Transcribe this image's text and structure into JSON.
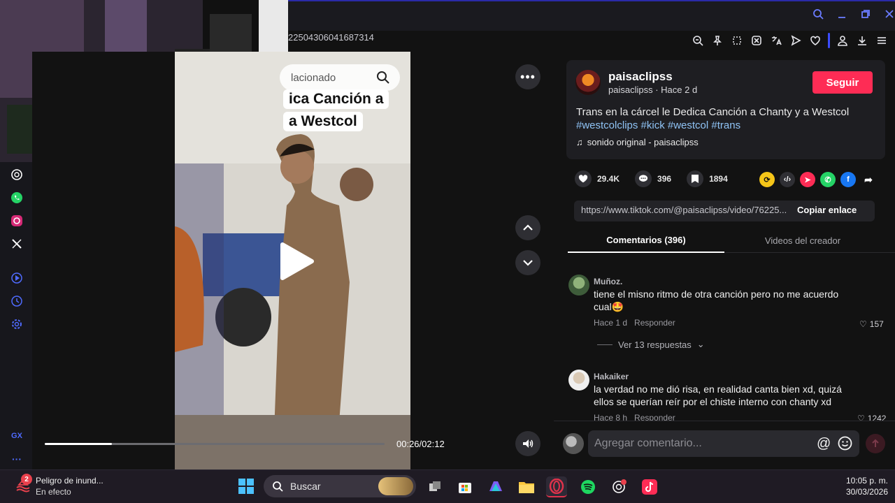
{
  "browser": {
    "url_fragment": "22504306041687314"
  },
  "video": {
    "related_label": "lacionado",
    "caption_line1": "ica Canción a",
    "caption_line2": "a Westcol",
    "time": "00:26/02:12",
    "progress": 0.197,
    "more_label": "•••"
  },
  "post": {
    "author": "paisaclipss",
    "author_sub": "paisaclipss · Hace 2 d",
    "follow_label": "Seguir",
    "desc_text": "Trans en la cárcel le Dedica Canción a Chanty y a Westcol",
    "desc_tags": "#westcolclips #kick #westcol #trans",
    "music": "sonido original - paisaclipss",
    "likes": "29.4K",
    "comments": "396",
    "saves": "1894",
    "link_url": "https://www.tiktok.com/@paisaclipss/video/76225...",
    "copy_label": "Copiar enlace"
  },
  "tabs": {
    "comments": "Comentarios (396)",
    "videos": "Videos del creador"
  },
  "comments": [
    {
      "name": "Muñoz.",
      "text": "tiene el misno ritmo de otra canción pero no me acuerdo cual🤩",
      "time": "Hace 1 d",
      "reply": "Responder",
      "likes": "157",
      "replies": "Ver 13 respuestas"
    },
    {
      "name": "Hakaiker",
      "text": "la verdad no me dió risa, en realidad canta bien xd, quizá ellos se querían reír por el chiste interno con chanty xd",
      "time": "Hace 8 h",
      "reply": "Responder",
      "likes": "1242"
    }
  ],
  "comment_input": {
    "placeholder": "Agregar comentario..."
  },
  "sidebar": {
    "gx_label": "GX",
    "more_label": "···"
  },
  "taskbar": {
    "weather_title": "Peligro de inund...",
    "weather_sub": "En efecto",
    "notif_count": "2",
    "search_label": "Buscar",
    "time": "10:05 p. m.",
    "date": "30/03/2026"
  },
  "icons": {
    "accent": "#fe2c55",
    "link_color": "#8fc3f5"
  }
}
